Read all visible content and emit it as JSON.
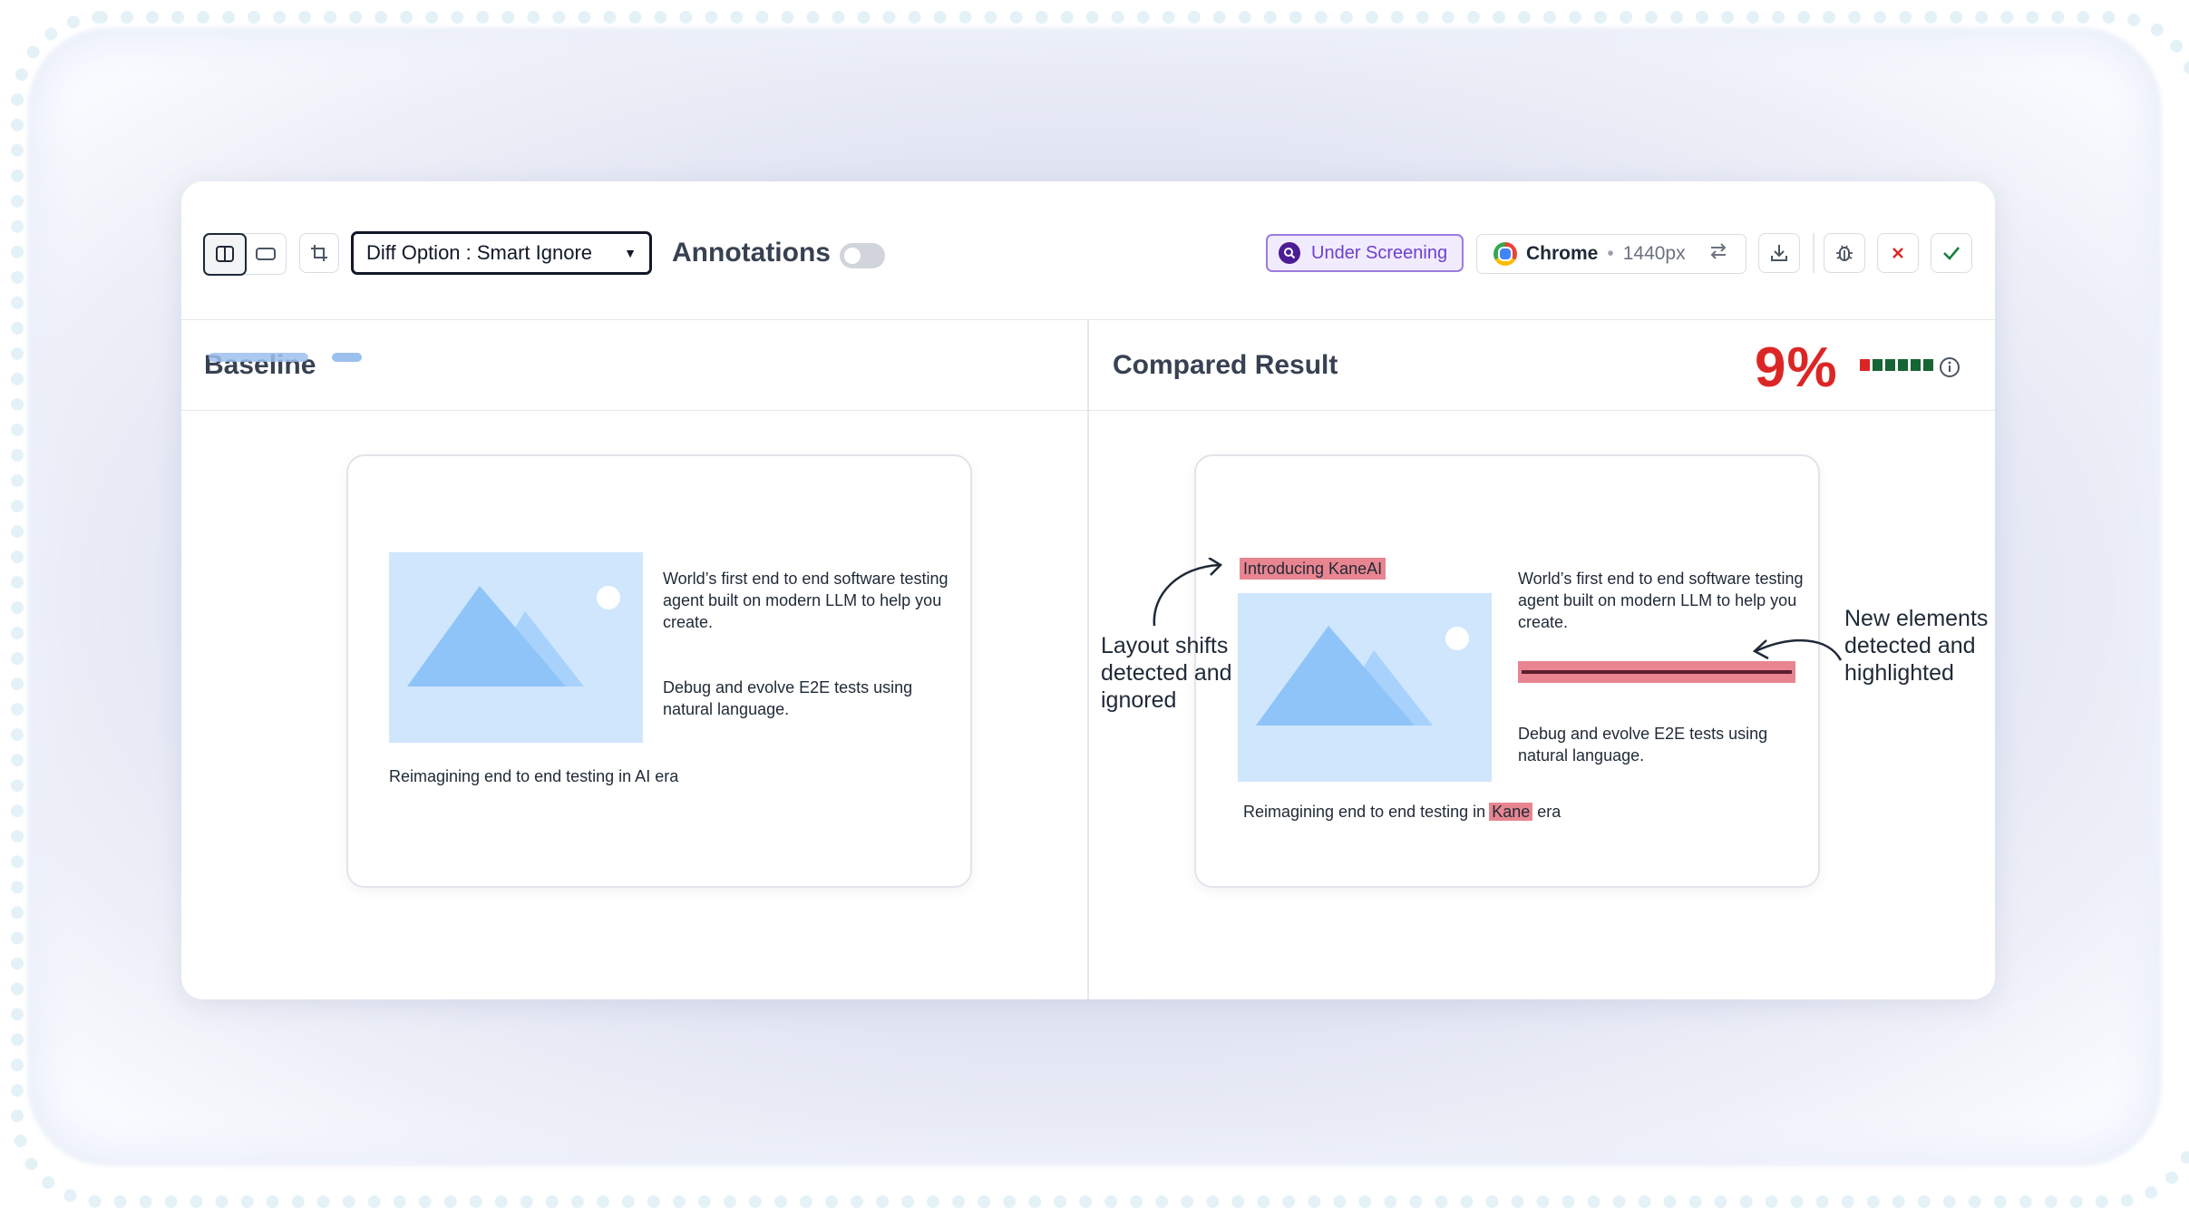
{
  "toolbar": {
    "diff_option_label": "Diff Option : Smart Ignore",
    "annotations_label": "Annotations",
    "annotations_on": false,
    "status_label": "Under Screening",
    "browser_name": "Chrome",
    "browser_separator": "•",
    "resolution": "1440px",
    "icons": [
      "split-view-icon",
      "single-view-icon",
      "crop-icon",
      "chevron-down-icon",
      "search-icon",
      "chrome-icon",
      "swap-icon",
      "download-icon",
      "bug-icon",
      "reject-icon",
      "approve-icon"
    ]
  },
  "baseline": {
    "title": "Baseline",
    "mock": {
      "paragraph1": "World’s first end to end software testing agent built on modern LLM to help you create.",
      "paragraph2": "Debug and evolve E2E tests using natural language.",
      "footer": "Reimagining end to end testing in AI era"
    }
  },
  "compared": {
    "title": "Compared Result",
    "diff_percent": "9%",
    "meter": {
      "filled_red": 1,
      "total": 6
    },
    "mock": {
      "badge": "Introducing KaneAI",
      "paragraph1": "World’s first end to end software testing agent built on modern LLM to help you create.",
      "paragraph2": "Debug and evolve E2E tests using natural language.",
      "footer_prefix": "Reimagining end to end testing in",
      "footer_highlight": "Kane",
      "footer_suffix": "era"
    },
    "annotations": {
      "left": "Layout shifts detected and ignored",
      "right": "New elements detected and highlighted"
    }
  },
  "colors": {
    "diff_red": "#dc2626",
    "highlight": "#e88590",
    "status_purple": "#6d3fd1",
    "image_placeholder": "#cfe6fd",
    "meter_green": "#166534"
  }
}
